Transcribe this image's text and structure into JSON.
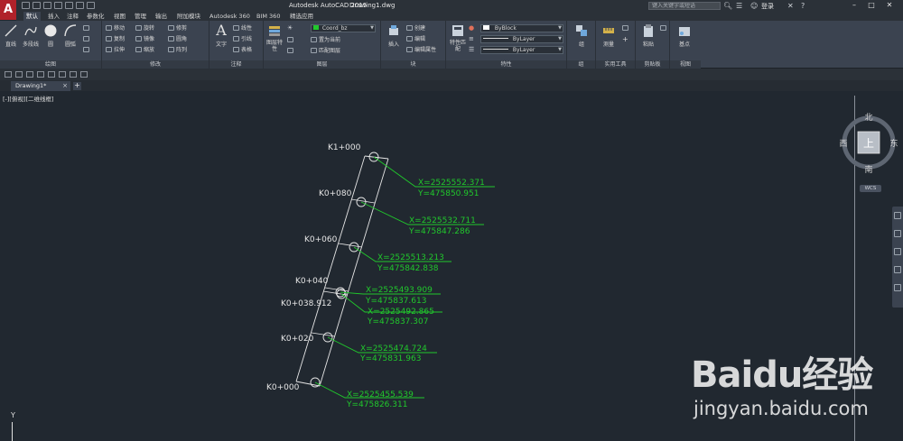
{
  "titlebar": {
    "app_title": "Autodesk AutoCAD 2015",
    "file_name": "Drawing1.dwg",
    "search_placeholder": "键入关键字或短语",
    "login_label": "登录"
  },
  "menu_tabs": [
    "默认",
    "插入",
    "注释",
    "参数化",
    "视图",
    "管理",
    "输出",
    "附加模块",
    "Autodesk 360",
    "BIM 360",
    "精选应用"
  ],
  "ribbon": {
    "draw": {
      "title": "绘图",
      "tools": [
        "直线",
        "多段线",
        "圆",
        "圆弧"
      ]
    },
    "modify": {
      "title": "修改",
      "tools": [
        "移动",
        "旋转",
        "修剪",
        "复制",
        "镜像",
        "圆角",
        "拉伸",
        "缩放",
        "阵列"
      ]
    },
    "annotation": {
      "title": "注释",
      "tools": [
        "文字",
        "线性",
        "引线",
        "标注",
        "表格"
      ]
    },
    "layers": {
      "title": "图层",
      "layer_properties": "图层特性",
      "current_layer": "Coord_bz",
      "tools": [
        "置为当前",
        "匹配图层"
      ]
    },
    "block": {
      "title": "块",
      "tools": [
        "插入",
        "创建",
        "编辑",
        "编辑属性"
      ]
    },
    "properties": {
      "title": "特性",
      "match": "特性匹配",
      "color_value": "ByBlock",
      "linetype_value": "ByLayer",
      "lineweight_value": "ByLayer"
    },
    "groups": {
      "title": "组",
      "tool": "组"
    },
    "utilities": {
      "title": "实用工具",
      "tool": "测量"
    },
    "clipboard": {
      "title": "剪贴板",
      "tool": "粘贴"
    },
    "view": {
      "title": "视图",
      "tool": "基点"
    }
  },
  "file_tab": {
    "label": "Drawing1*"
  },
  "viewport": {
    "label": "[-][俯视][二维线框]"
  },
  "viewcube": {
    "north": "北",
    "south": "南",
    "east": "东",
    "west": "西",
    "face": "上",
    "wcs": "WCS"
  },
  "ucs": {
    "y_label": "Y"
  },
  "drawing": {
    "stations": [
      "K1+000",
      "K0+080",
      "K0+060",
      "K0+040",
      "K0+038.912",
      "K0+020",
      "K0+000"
    ],
    "coordinates": [
      {
        "station": "K1+000",
        "x_text": "X=2525552.371",
        "y_text": "Y=475850.951"
      },
      {
        "station": "K0+080",
        "x_text": "X=2525532.711",
        "y_text": "Y=475847.286"
      },
      {
        "station": "K0+060",
        "x_text": "X=2525513.213",
        "y_text": "Y=475842.838"
      },
      {
        "station": "K0+040",
        "x_text": "X=2525493.909",
        "y_text": "Y=475837.613"
      },
      {
        "station": "K0+038.912",
        "x_text": "X=2525492.865",
        "y_text": "Y=475837.307"
      },
      {
        "station": "K0+020",
        "x_text": "X=2525474.724",
        "y_text": "Y=475831.963"
      },
      {
        "station": "K0+000",
        "x_text": "X=2525455.539",
        "y_text": "Y=475826.311"
      }
    ],
    "colors": {
      "leader": "#21c82c",
      "station_text": "#e6e6e6",
      "alignment": "#e6e6e6",
      "background": "#212830"
    }
  },
  "watermark": {
    "logo": "Baidu经验",
    "url": "jingyan.baidu.com"
  }
}
